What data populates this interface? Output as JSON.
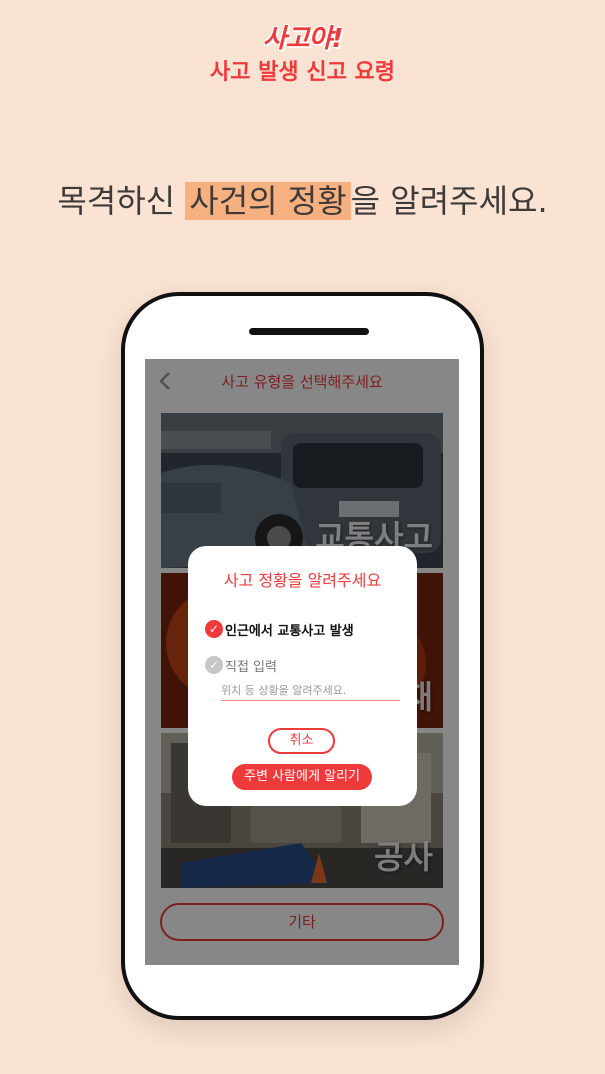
{
  "header": {
    "logo_text": "사고야!",
    "subtitle": "사고 발생 신고 요령"
  },
  "headline": {
    "before": "목격하신 ",
    "highlight": "사건의 정황",
    "after": "을 알려주세요."
  },
  "screen": {
    "title": "사고 유형을 선택해주세요",
    "back_icon": "chevron-left-icon",
    "categories": [
      {
        "label": "교통사고"
      },
      {
        "label": "화재"
      },
      {
        "label": "공사"
      }
    ],
    "etc_label": "기타"
  },
  "modal": {
    "title": "사고 정황을 알려주세요",
    "options": [
      {
        "label": "인근에서 교통사고 발생",
        "checked": true
      },
      {
        "label": "직접 입력",
        "checked": false
      }
    ],
    "input_placeholder": "위치 등 상황을 알려주세요.",
    "cancel_label": "취소",
    "notify_label": "주변 사람에게 알리기"
  },
  "colors": {
    "accent": "#ef3a3c",
    "background": "#fbe3d3",
    "highlight": "#f7b07f"
  }
}
